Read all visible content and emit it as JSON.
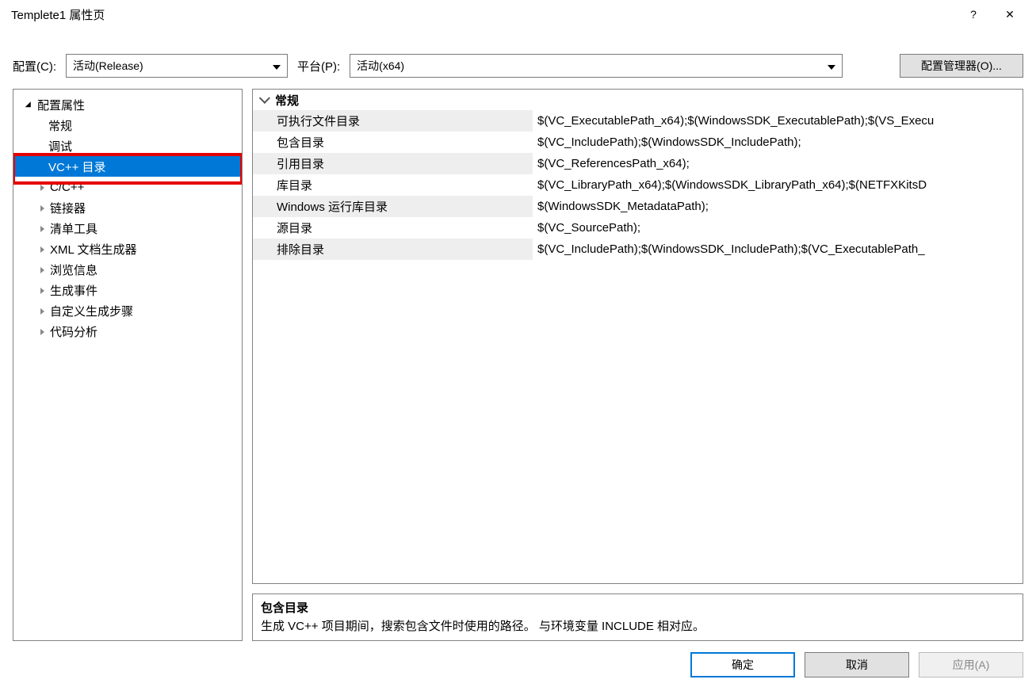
{
  "titlebar": {
    "title": "Templete1 属性页",
    "help_label": "?",
    "close_label": "✕"
  },
  "toprow": {
    "config_label": "配置(C):",
    "config_value": "活动(Release)",
    "platform_label": "平台(P):",
    "platform_value": "活动(x64)",
    "cfgmgr_label": "配置管理器(O)..."
  },
  "tree": {
    "root": "配置属性",
    "items": [
      {
        "label": "常规",
        "expandable": false
      },
      {
        "label": "调试",
        "expandable": false
      },
      {
        "label": "VC++ 目录",
        "expandable": false,
        "selected": true
      },
      {
        "label": "C/C++",
        "expandable": true
      },
      {
        "label": "链接器",
        "expandable": true
      },
      {
        "label": "清单工具",
        "expandable": true
      },
      {
        "label": "XML 文档生成器",
        "expandable": true
      },
      {
        "label": "浏览信息",
        "expandable": true
      },
      {
        "label": "生成事件",
        "expandable": true
      },
      {
        "label": "自定义生成步骤",
        "expandable": true
      },
      {
        "label": "代码分析",
        "expandable": true
      }
    ]
  },
  "propgrid": {
    "group": "常规",
    "rows": [
      {
        "label": "可执行文件目录",
        "value": "$(VC_ExecutablePath_x64);$(WindowsSDK_ExecutablePath);$(VS_Execu"
      },
      {
        "label": "包含目录",
        "value": "$(VC_IncludePath);$(WindowsSDK_IncludePath);"
      },
      {
        "label": "引用目录",
        "value": "$(VC_ReferencesPath_x64);"
      },
      {
        "label": "库目录",
        "value": "$(VC_LibraryPath_x64);$(WindowsSDK_LibraryPath_x64);$(NETFXKitsD"
      },
      {
        "label": "Windows 运行库目录",
        "value": "$(WindowsSDK_MetadataPath);"
      },
      {
        "label": "源目录",
        "value": "$(VC_SourcePath);"
      },
      {
        "label": "排除目录",
        "value": "$(VC_IncludePath);$(WindowsSDK_IncludePath);$(VC_ExecutablePath_"
      }
    ]
  },
  "description": {
    "heading": "包含目录",
    "body": "生成 VC++ 项目期间，搜索包含文件时使用的路径。    与环境变量 INCLUDE 相对应。"
  },
  "buttons": {
    "ok": "确定",
    "cancel": "取消",
    "apply": "应用(A)"
  }
}
